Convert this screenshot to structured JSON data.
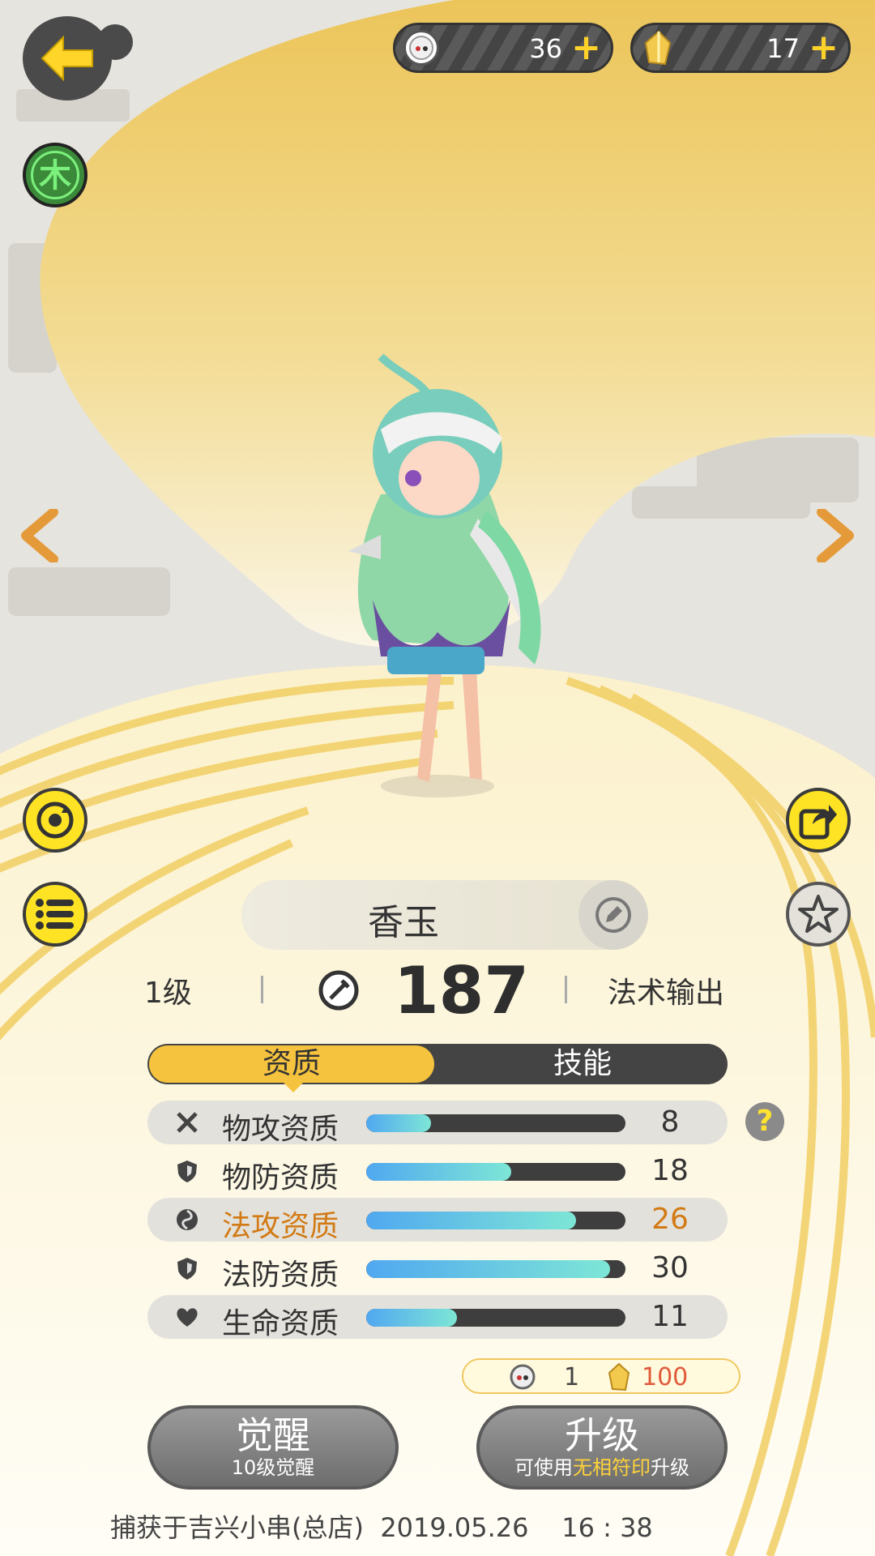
{
  "currency": [
    {
      "icon": "spirit-orb-icon",
      "amount": "36",
      "plus": "+"
    },
    {
      "icon": "crystal-icon",
      "amount": "17",
      "plus": "+"
    }
  ],
  "element_badge": "木",
  "pet": {
    "name": "香玉",
    "level": "1级",
    "power": "187",
    "role": "法术输出"
  },
  "tabs": {
    "active": "资质",
    "other": "技能"
  },
  "stats": [
    {
      "icon": "crossed-swords-icon",
      "label": "物攻资质",
      "value": "8",
      "fill": 0.25
    },
    {
      "icon": "shield-icon",
      "label": "物防资质",
      "value": "18",
      "fill": 0.56
    },
    {
      "icon": "magic-swirl-icon",
      "label": "法攻资质",
      "value": "26",
      "fill": 0.81,
      "highlight": true
    },
    {
      "icon": "shield-icon",
      "label": "法防资质",
      "value": "30",
      "fill": 0.94
    },
    {
      "icon": "heart-icon",
      "label": "生命资质",
      "value": "11",
      "fill": 0.35
    }
  ],
  "help": "?",
  "cost": {
    "orb": "1",
    "crystal": "100"
  },
  "awaken": {
    "title": "觉醒",
    "sub": "10级觉醒"
  },
  "upgrade": {
    "title": "升级",
    "sub_pre": "可使用",
    "sub_hl": "无相符印",
    "sub_post": "升级"
  },
  "footer": "捕获于吉兴小串(总店)  2019.05.26    16 : 38",
  "colors": {
    "accent": "#f6c33e",
    "button_yellow": "#fde323",
    "highlight": "#d27a14"
  }
}
